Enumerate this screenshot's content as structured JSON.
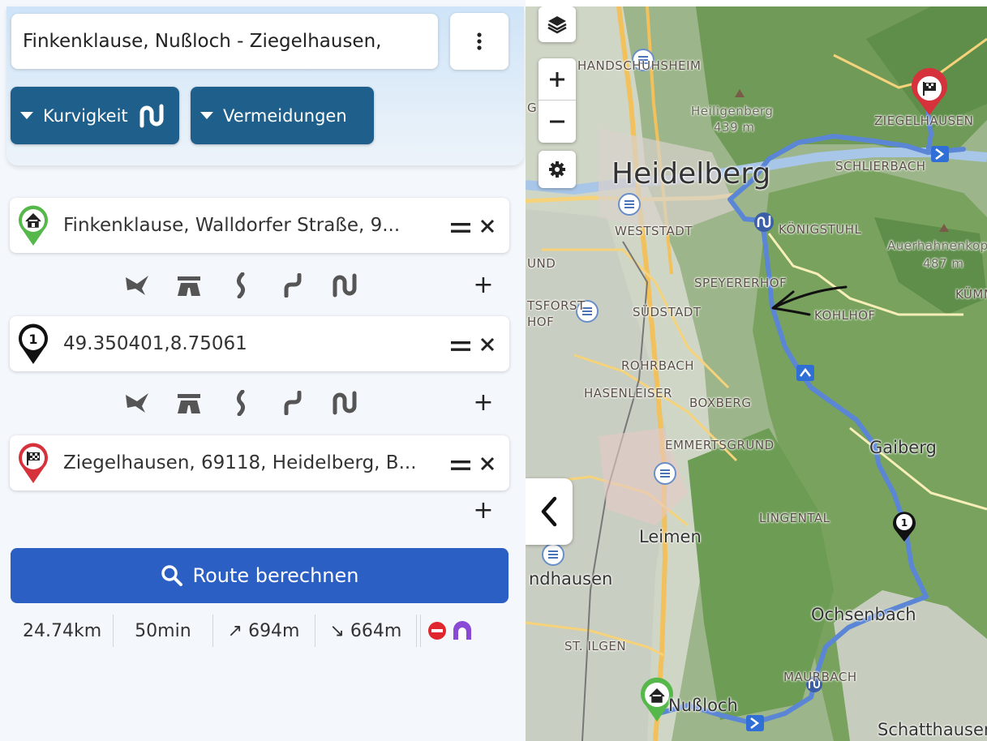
{
  "panel": {
    "search_value": "Finkenklause, Nußloch - Ziegelhausen,",
    "menu_icon": "vertical-dots-icon",
    "buttons": {
      "curviness": "Kurvigkeit",
      "avoidances": "Vermeidungen"
    },
    "waypoints": [
      {
        "icon": "home-pin",
        "label": "Finkenklause, Walldorfer Straße, 9..."
      },
      {
        "icon": "number-pin",
        "number": "1",
        "label": "49.350401,8.75061"
      },
      {
        "icon": "finish-flag-pin",
        "label": "Ziegelhausen, 69118, Heidelberg, B..."
      }
    ],
    "route_button": "Route berechnen",
    "stats": {
      "distance": "24.74km",
      "duration": "50min",
      "ascent": "↗ 694m",
      "descent": "↘ 664m"
    },
    "colors": {
      "primary_button": "#2b5fc4",
      "dropdown_button": "#1f5f8b",
      "route_line": "#5b86d6",
      "home_pin": "#56b84a",
      "finish_pin": "#d6323c"
    }
  },
  "map": {
    "labels": {
      "handschuhsheim": "HANDSCHUHSHEIM",
      "heiligenberg": "Heiligenberg",
      "heiligenberg_elev": "439 m",
      "ziegelhausen": "ZIEGELHAUSEN",
      "schlierbach": "SCHLIERBACH",
      "heidelberg": "Heidelberg",
      "weststadt": "WESTSTADT",
      "koenigstuhl": "KÖNIGSTUHL",
      "auerhahnenkopf": "Auerhahnenkopf",
      "auerhahnenkopf_elev": "487 m",
      "speyererhof": "SPEYERERHOF",
      "suedstadt": "SÜDSTADT",
      "kohlhof": "KOHLHOF",
      "kuemmelbacherhof": "KÜMM",
      "rohrbach": "ROHRBACH",
      "hasenleiser": "HASENLEISER",
      "boxberg": "BOXBERG",
      "emmertsgrund": "EMMERTSGRUND",
      "gaiberg": "Gaiberg",
      "lingental": "LINGENTAL",
      "leimen": "Leimen",
      "sandhausen": "ndhausen",
      "ochsenbach": "Ochsenbach",
      "st_ilgen": "ST. ILGEN",
      "maurbach": "MAURBACH",
      "nussloch": "Nußloch",
      "schatthausen": "Schatthausen",
      "forst": "TSFORST",
      "hof": "HOF",
      "und": "UND",
      "g": "G"
    },
    "route_marker_number": "1"
  }
}
